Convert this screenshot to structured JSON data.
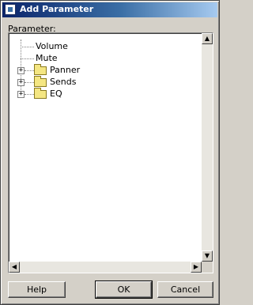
{
  "window": {
    "title": "Add Parameter",
    "app_icon": "window-icon"
  },
  "parameter_label": "Parameter:",
  "tree": {
    "items": [
      {
        "label": "Volume",
        "type": "leaf"
      },
      {
        "label": "Mute",
        "type": "leaf"
      },
      {
        "label": "Panner",
        "type": "folder",
        "expander": "+"
      },
      {
        "label": "Sends",
        "type": "folder",
        "expander": "+"
      },
      {
        "label": "EQ",
        "type": "folder",
        "expander": "+"
      }
    ]
  },
  "scroll": {
    "up": "▲",
    "down": "▼",
    "left": "◀",
    "right": "▶"
  },
  "buttons": {
    "help": "Help",
    "ok": "OK",
    "cancel": "Cancel"
  }
}
